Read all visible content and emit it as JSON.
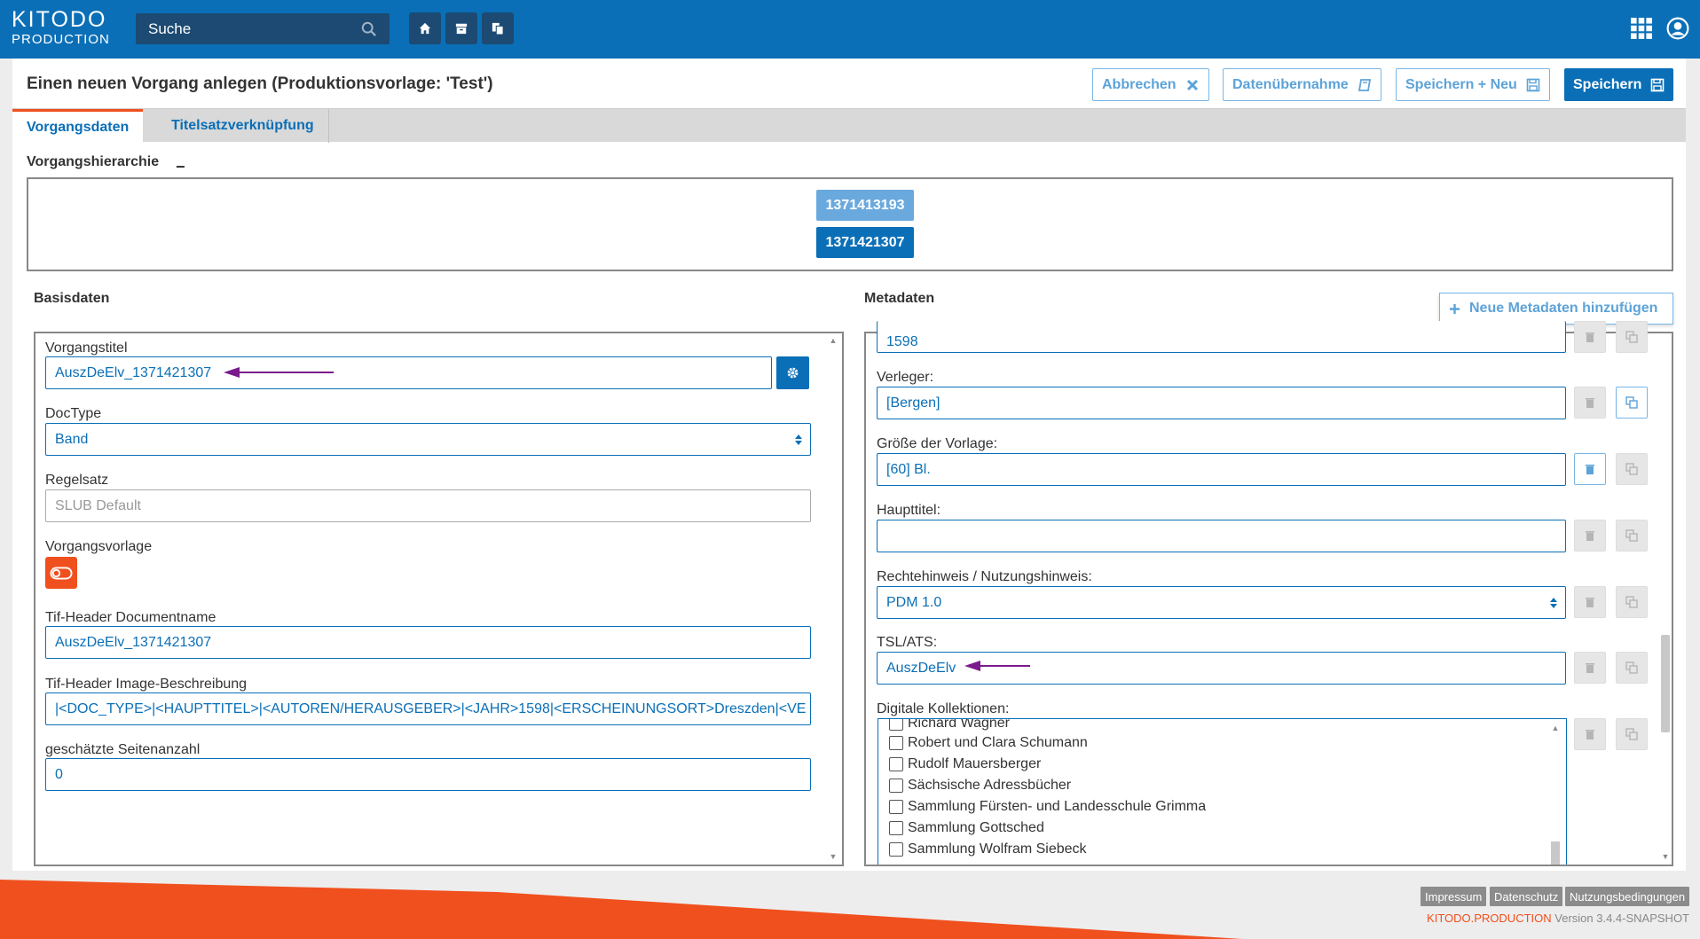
{
  "logo": {
    "line1": "KITODO",
    "line2": "PRODUCTION"
  },
  "search": {
    "placeholder": "Suche"
  },
  "header": {
    "title": "Einen neuen Vorgang anlegen (Produktionsvorlage: 'Test')",
    "buttons": {
      "cancel": "Abbrechen",
      "import": "Datenübernahme",
      "save_new": "Speichern + Neu",
      "save": "Speichern"
    }
  },
  "tabs": [
    {
      "label": "Vorgangsdaten"
    },
    {
      "label": "Titelsatzverknüpfung"
    }
  ],
  "hierarchy": {
    "title": "Vorgangshierarchie",
    "collapse": "−",
    "nodes": [
      "1371413193",
      "1371421307"
    ]
  },
  "basisdaten": {
    "title": "Basisdaten",
    "fields": {
      "title_label": "Vorgangstitel",
      "title_value": "AuszDeElv_1371421307",
      "doctype_label": "DocType",
      "doctype_value": "Band",
      "ruleset_label": "Regelsatz",
      "ruleset_value": "SLUB Default",
      "template_label": "Vorgangsvorlage",
      "tif_name_label": "Tif-Header Documentname",
      "tif_name_value": "AuszDeElv_1371421307",
      "tif_desc_label": "Tif-Header Image-Beschreibung",
      "tif_desc_value": "|<DOC_TYPE>|<HAUPTTITEL>|<AUTOREN/HERAUSGEBER>|<JAHR>1598|<ERSCHEINUNGSORT>Dreszden|<VE",
      "pages_label": "geschätzte Seitenanzahl",
      "pages_value": "0"
    }
  },
  "metadaten": {
    "title": "Metadaten",
    "add_button": "Neue Metadaten hinzufügen",
    "partial_value": "1598",
    "fields": {
      "publisher_label": "Verleger:",
      "publisher_value": "[Bergen]",
      "size_label": "Größe der Vorlage:",
      "size_value": "[60] Bl.",
      "main_title_label": "Haupttitel:",
      "main_title_value": "",
      "rights_label": "Rechtehinweis / Nutzungshinweis:",
      "rights_value": "PDM 1.0",
      "tsl_label": "TSL/ATS:",
      "tsl_value": "AuszDeElv",
      "collections_label": "Digitale Kollektionen:"
    },
    "collections": [
      "Richard Wagner",
      "Robert und Clara Schumann",
      "Rudolf Mauersberger",
      "Sächsische Adressbücher",
      "Sammlung Fürsten- und Landesschule Grimma",
      "Sammlung Gottsched",
      "Sammlung Wolfram Siebeck"
    ]
  },
  "footer": {
    "links": [
      "Impressum",
      "Datenschutz",
      "Nutzungsbedingungen"
    ],
    "brand": "KITODO.PRODUCTION",
    "version": "Version 3.4.4-SNAPSHOT"
  },
  "colors": {
    "primary": "#0a6fb7",
    "accent": "#f0501e",
    "annotation_arrow": "#7b1a8c"
  },
  "icons": [
    "search-icon",
    "home-icon",
    "archive-icon",
    "copy-icon",
    "apps-grid-icon",
    "user-icon",
    "close-icon",
    "book-icon",
    "save-icon",
    "gear-icon",
    "toggle-icon",
    "trash-icon",
    "duplicate-icon",
    "plus-icon"
  ]
}
